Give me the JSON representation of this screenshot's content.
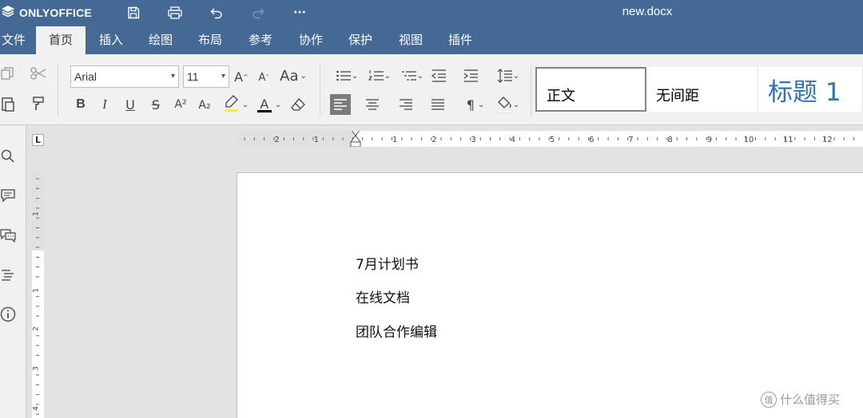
{
  "app": {
    "brand": "ONLYOFFICE",
    "doc_title": "new.docx"
  },
  "title_icons": [
    "save-icon",
    "print-icon",
    "undo-icon",
    "redo-icon",
    "more-icon"
  ],
  "title_more": "···",
  "menu": {
    "tabs": [
      {
        "label": "文件",
        "active": false
      },
      {
        "label": "首页",
        "active": true
      },
      {
        "label": "插入",
        "active": false
      },
      {
        "label": "绘图",
        "active": false
      },
      {
        "label": "布局",
        "active": false
      },
      {
        "label": "参考",
        "active": false
      },
      {
        "label": "协作",
        "active": false
      },
      {
        "label": "保护",
        "active": false
      },
      {
        "label": "视图",
        "active": false
      },
      {
        "label": "插件",
        "active": false
      }
    ]
  },
  "toolbar": {
    "font_name": "Arial",
    "font_size": "11",
    "grow_font": "A",
    "shrink_font": "A",
    "change_case": "Aa",
    "bold": "B",
    "italic": "I",
    "underline": "U",
    "strike": "S",
    "superscript": "A²",
    "subscript": "A₂",
    "font_color_letter": "A",
    "paragraph_mark": "¶"
  },
  "styles": [
    {
      "label": "正文",
      "selected": true
    },
    {
      "label": "无间距",
      "selected": false
    },
    {
      "label": "标题 1",
      "selected": false
    }
  ],
  "ruler": {
    "corner_label": "L",
    "h_numbers": [
      "2",
      "1",
      "1",
      "2",
      "3",
      "4",
      "5",
      "6",
      "7",
      "8",
      "9",
      "10",
      "11",
      "12"
    ],
    "v_numbers": [
      "1",
      "1",
      "2",
      "3",
      "4"
    ]
  },
  "document": {
    "paragraphs": [
      "7月计划书",
      "在线文档",
      "团队合作编辑"
    ]
  },
  "watermark": {
    "text": "什么值得买",
    "icon_text": "值"
  },
  "colors": {
    "header_bg": "#446995",
    "toolbar_bg": "#f1f1f1",
    "heading_blue": "#2e74b5",
    "highlight_yellow": "#ffeb3b"
  }
}
